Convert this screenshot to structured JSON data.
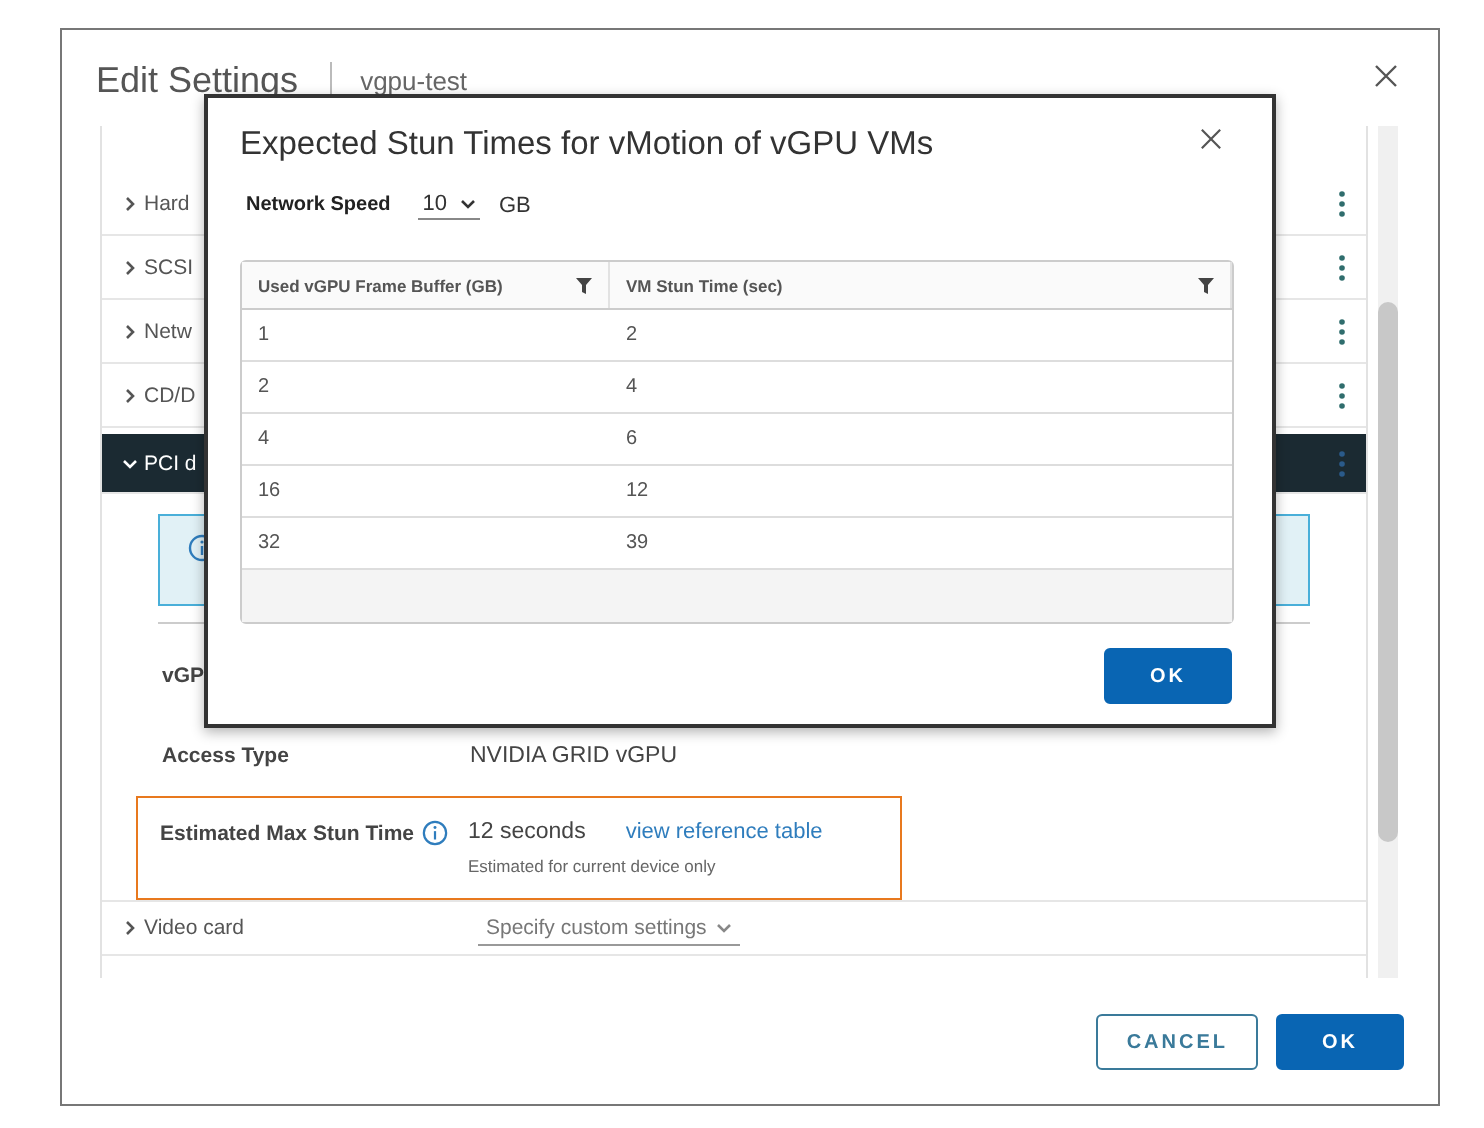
{
  "dialog": {
    "title": "Edit Settings",
    "subtitle": "vgpu-test",
    "sections": [
      {
        "label": "Hard",
        "expanded": false
      },
      {
        "label": "SCSI",
        "expanded": false
      },
      {
        "label": "Netw",
        "expanded": false
      },
      {
        "label": "CD/D",
        "expanded": false
      },
      {
        "label": "PCI d",
        "expanded": true
      }
    ],
    "fields": [
      {
        "label": "vGP"
      },
      {
        "label": "Access Type",
        "value": "NVIDIA GRID vGPU",
        "highlighted": false
      },
      {
        "label": "Estimated Max Stun Time",
        "value": "12 seconds",
        "link": "view reference table",
        "hint": "Estimated for current device only",
        "highlighted": true
      }
    ],
    "video_card": {
      "label": "Video card",
      "value": "Specify custom settings",
      "expanded": false
    },
    "buttons": [
      {
        "label": "CANCEL",
        "kind": "secondary"
      },
      {
        "label": "OK",
        "kind": "primary"
      }
    ]
  },
  "modal": {
    "title": "Expected Stun Times for vMotion of vGPU VMs",
    "network_speed": {
      "label": "Network Speed",
      "value": "10",
      "unit": "GB"
    },
    "table": {
      "columns": [
        "Used vGPU Frame Buffer (GB)",
        "VM Stun Time (sec)"
      ],
      "rows": [
        [
          "1",
          "2"
        ],
        [
          "2",
          "4"
        ],
        [
          "4",
          "6"
        ],
        [
          "16",
          "12"
        ],
        [
          "32",
          "39"
        ]
      ]
    },
    "buttons": [
      {
        "label": "OK",
        "kind": "primary"
      }
    ]
  }
}
